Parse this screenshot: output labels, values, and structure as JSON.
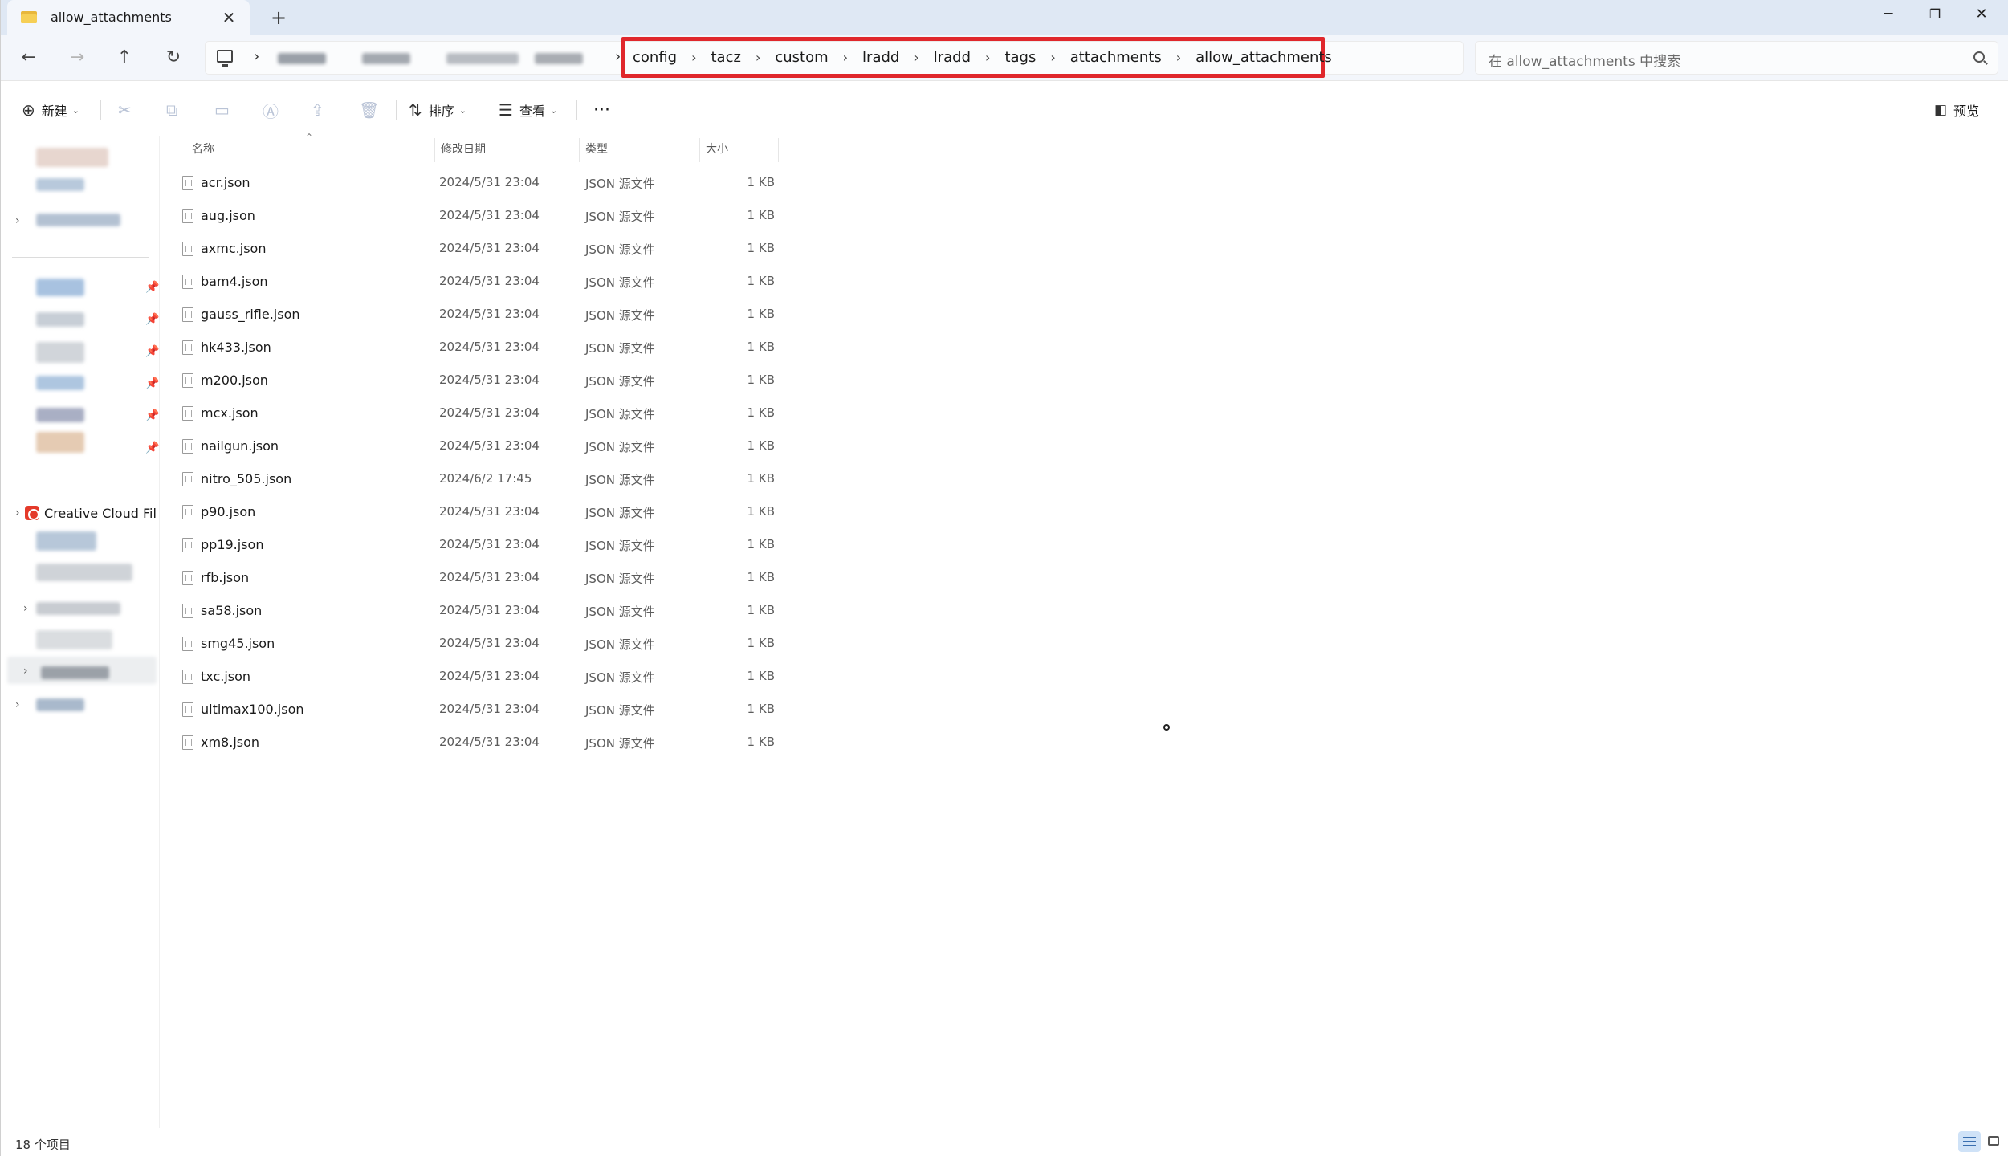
{
  "titlebar": {
    "tab_title": "allow_attachments",
    "tab_close": "✕",
    "new_tab": "+",
    "minimize": "─",
    "restore": "❐",
    "close": "✕"
  },
  "nav": {
    "back": "←",
    "forward": "→",
    "up": "↑",
    "refresh": "↻",
    "sep": "›"
  },
  "breadcrumb": [
    "config",
    "tacz",
    "custom",
    "lradd",
    "lradd",
    "tags",
    "attachments",
    "allow_attachments"
  ],
  "search": {
    "placeholder": "在 allow_attachments 中搜索"
  },
  "toolbar": {
    "new_label": "新建",
    "sort_label": "排序",
    "view_label": "查看",
    "more_label": "···",
    "preview_label": "预览"
  },
  "sidebar": {
    "creative_cloud_label": "Creative Cloud Fil"
  },
  "columns": {
    "name": "名称",
    "date": "修改日期",
    "type": "类型",
    "size": "大小"
  },
  "files": [
    {
      "name": "acr.json",
      "date": "2024/5/31 23:04",
      "type": "JSON 源文件",
      "size": "1 KB"
    },
    {
      "name": "aug.json",
      "date": "2024/5/31 23:04",
      "type": "JSON 源文件",
      "size": "1 KB"
    },
    {
      "name": "axmc.json",
      "date": "2024/5/31 23:04",
      "type": "JSON 源文件",
      "size": "1 KB"
    },
    {
      "name": "bam4.json",
      "date": "2024/5/31 23:04",
      "type": "JSON 源文件",
      "size": "1 KB"
    },
    {
      "name": "gauss_rifle.json",
      "date": "2024/5/31 23:04",
      "type": "JSON 源文件",
      "size": "1 KB"
    },
    {
      "name": "hk433.json",
      "date": "2024/5/31 23:04",
      "type": "JSON 源文件",
      "size": "1 KB"
    },
    {
      "name": "m200.json",
      "date": "2024/5/31 23:04",
      "type": "JSON 源文件",
      "size": "1 KB"
    },
    {
      "name": "mcx.json",
      "date": "2024/5/31 23:04",
      "type": "JSON 源文件",
      "size": "1 KB"
    },
    {
      "name": "nailgun.json",
      "date": "2024/5/31 23:04",
      "type": "JSON 源文件",
      "size": "1 KB"
    },
    {
      "name": "nitro_505.json",
      "date": "2024/6/2 17:45",
      "type": "JSON 源文件",
      "size": "1 KB"
    },
    {
      "name": "p90.json",
      "date": "2024/5/31 23:04",
      "type": "JSON 源文件",
      "size": "1 KB"
    },
    {
      "name": "pp19.json",
      "date": "2024/5/31 23:04",
      "type": "JSON 源文件",
      "size": "1 KB"
    },
    {
      "name": "rfb.json",
      "date": "2024/5/31 23:04",
      "type": "JSON 源文件",
      "size": "1 KB"
    },
    {
      "name": "sa58.json",
      "date": "2024/5/31 23:04",
      "type": "JSON 源文件",
      "size": "1 KB"
    },
    {
      "name": "smg45.json",
      "date": "2024/5/31 23:04",
      "type": "JSON 源文件",
      "size": "1 KB"
    },
    {
      "name": "txc.json",
      "date": "2024/5/31 23:04",
      "type": "JSON 源文件",
      "size": "1 KB"
    },
    {
      "name": "ultimax100.json",
      "date": "2024/5/31 23:04",
      "type": "JSON 源文件",
      "size": "1 KB"
    },
    {
      "name": "xm8.json",
      "date": "2024/5/31 23:04",
      "type": "JSON 源文件",
      "size": "1 KB"
    }
  ],
  "status": {
    "item_count": "18 个项目"
  },
  "colors": {
    "highlight": "#e0272c",
    "titlebar": "#dfe8f4",
    "accent": "#3a6fb0"
  }
}
